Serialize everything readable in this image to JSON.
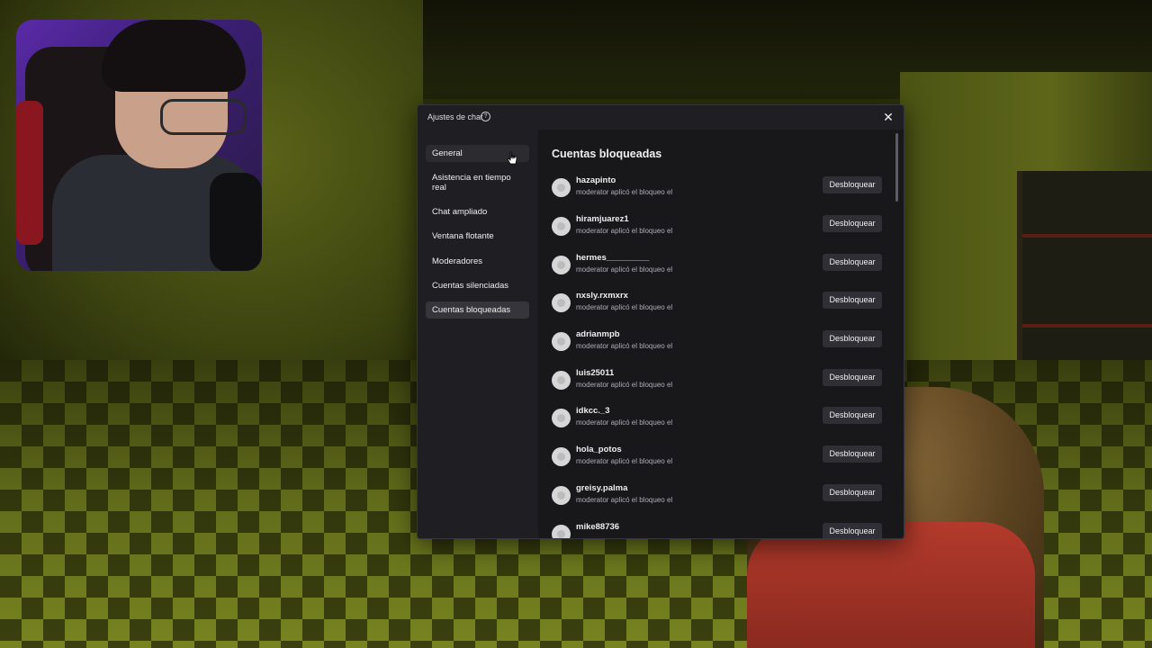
{
  "dialog": {
    "title": "Ajustes de chat",
    "help_icon": "question-circle-icon",
    "close_icon": "close-icon",
    "close_glyph": "✕"
  },
  "sidebar": {
    "items": [
      {
        "label": "General",
        "state": "hovered"
      },
      {
        "label": "Asistencia en tiempo real",
        "state": "normal"
      },
      {
        "label": "Chat ampliado",
        "state": "normal"
      },
      {
        "label": "Ventana flotante",
        "state": "normal"
      },
      {
        "label": "Moderadores",
        "state": "normal"
      },
      {
        "label": "Cuentas silenciadas",
        "state": "normal"
      },
      {
        "label": "Cuentas bloqueadas",
        "state": "active"
      }
    ]
  },
  "main": {
    "title": "Cuentas bloqueadas",
    "unblock_label": "Desbloquear",
    "rows": [
      {
        "username": "hazapinto",
        "meta": "moderator aplicó el bloqueo el"
      },
      {
        "username": "hiramjuarez1",
        "meta": "moderator aplicó el bloqueo el"
      },
      {
        "username": "hermes_________",
        "meta": "moderator aplicó el bloqueo el"
      },
      {
        "username": "nxsly.rxmxrx",
        "meta": "moderator aplicó el bloqueo el"
      },
      {
        "username": "adrianmpb",
        "meta": "moderator aplicó el bloqueo el"
      },
      {
        "username": "luis25011",
        "meta": "moderator aplicó el bloqueo el"
      },
      {
        "username": "idkcc._3",
        "meta": "moderator aplicó el bloqueo el"
      },
      {
        "username": "hola_potos",
        "meta": "moderator aplicó el bloqueo el"
      },
      {
        "username": "greisy.palma",
        "meta": "moderator aplicó el bloqueo el"
      },
      {
        "username": "mike88736",
        "meta": ""
      }
    ]
  },
  "colors": {
    "dialog_bg": "#1f1f23",
    "main_bg": "#18181b",
    "button_bg": "#2f2f35",
    "active_item_bg": "#35353b",
    "text": "#efeff1",
    "muted_text": "#adadb8"
  }
}
